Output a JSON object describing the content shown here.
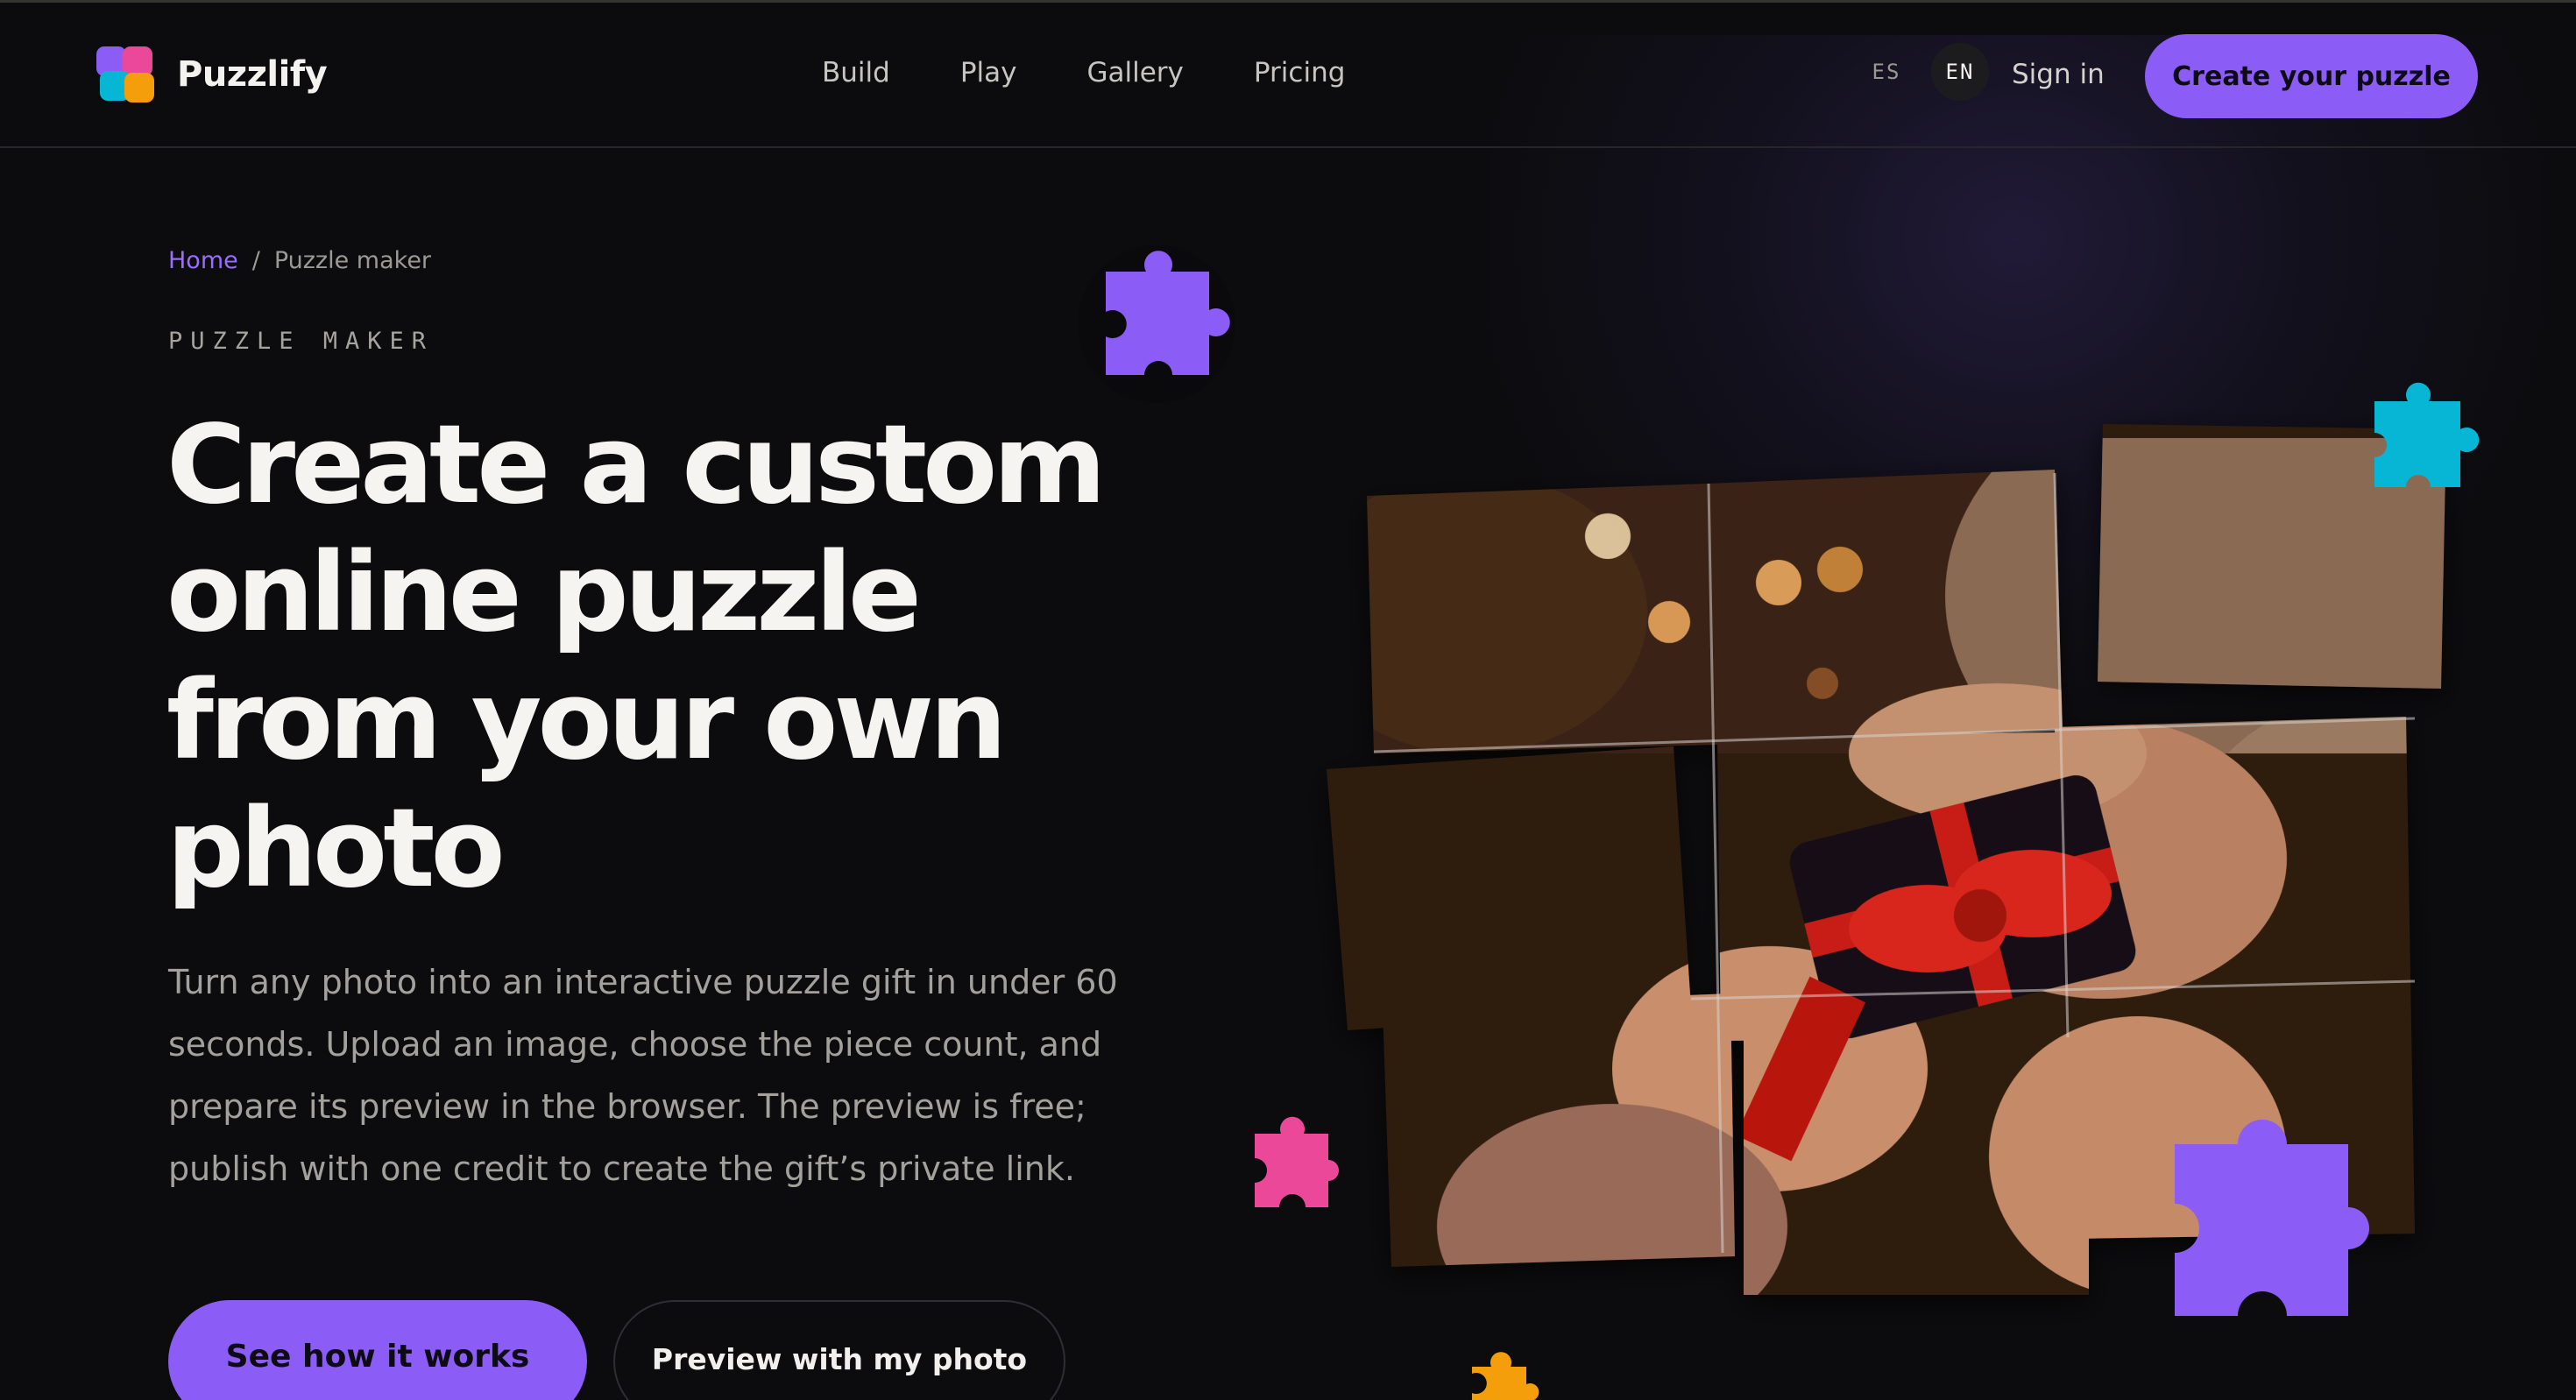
{
  "brand": {
    "name": "Puzzlify"
  },
  "nav": {
    "items": [
      "Build",
      "Play",
      "Gallery",
      "Pricing"
    ]
  },
  "header": {
    "languages": [
      {
        "code": "ES",
        "active": false
      },
      {
        "code": "EN",
        "active": true
      }
    ],
    "sign_in": "Sign in",
    "cta": "Create your puzzle"
  },
  "breadcrumb": {
    "home": "Home",
    "separator": "/",
    "current": "Puzzle maker"
  },
  "hero": {
    "eyebrow": "PUZZLE MAKER",
    "title_lines": [
      "Create a custom",
      "online puzzle",
      "from your own",
      "photo"
    ],
    "description": "Turn any photo into an interactive puzzle gift in under 60 seconds. Upload an image, choose the piece count, and prepare its preview in the browser. The preview is free; publish with one credit to create the gift’s private link.",
    "primary_button": "See how it works",
    "secondary_button": "Preview with my photo"
  },
  "colors": {
    "accent": "#8b5cf6",
    "background": "#0c0c0e",
    "piece_purple": "#8b5cf6",
    "piece_cyan": "#06b6d4",
    "piece_pink": "#ec4899",
    "piece_orange": "#f59e0b"
  },
  "icons": [
    "logo-puzzle-icon",
    "puzzle-piece-icon"
  ]
}
